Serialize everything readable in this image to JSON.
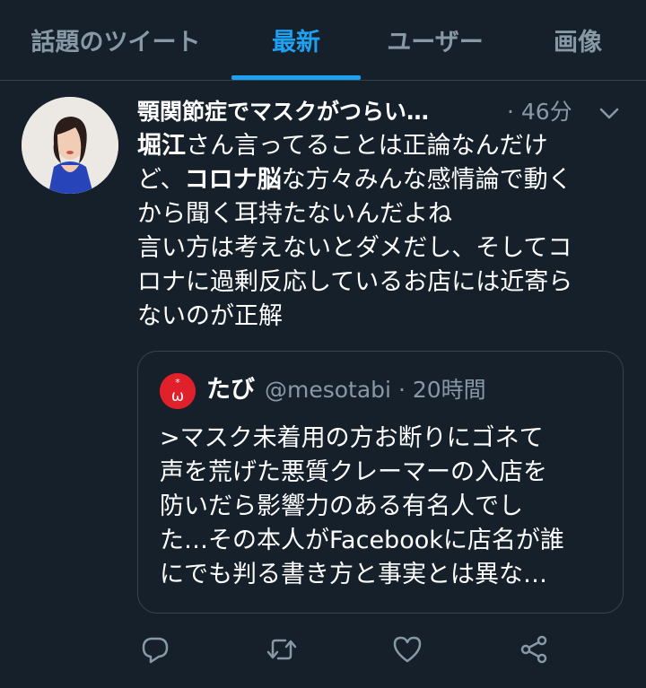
{
  "tabs": [
    {
      "label": "話題のツイート",
      "active": false
    },
    {
      "label": "最新",
      "active": true
    },
    {
      "label": "ユーザー",
      "active": false
    },
    {
      "label": "画像",
      "active": false
    }
  ],
  "tweet": {
    "author_name": "顎関節症でマスクがつらい…",
    "time": "· 46分",
    "text": {
      "line1_bold": "堀江",
      "line1_rest": "さん言ってることは正論なんだけ",
      "line2_a": "ど、",
      "line2_bold": "コロナ脳",
      "line2_b": "な方々みんな感情論で動く",
      "line3": "から聞く耳持たないんだよね",
      "line4": "言い方は考えないとダメだし、そしてコ",
      "line5": "ロナに過剰反応しているお店には近寄ら",
      "line6": "ないのが正解"
    },
    "avatar_icon": "user-photo-avatar"
  },
  "quote": {
    "author_name": "たび",
    "handle_time": "@mesotabi · 20時間",
    "lines": [
      ">マスク未着用の方お断りにゴネて",
      "声を荒げた悪質クレーマーの入店を",
      "防いだら影響力のある有名人でし",
      "た…その本人がFacebookに店名が誰",
      "にでも判る書き方と事実とは異な…"
    ],
    "avatar_glyph": "ω"
  },
  "actions": {
    "icons": [
      "reply-icon",
      "retweet-icon",
      "like-icon",
      "share-icon"
    ]
  },
  "colors": {
    "background": "#15202b",
    "accent": "#1da1f2",
    "muted": "#8899a6",
    "border": "#38444d"
  }
}
